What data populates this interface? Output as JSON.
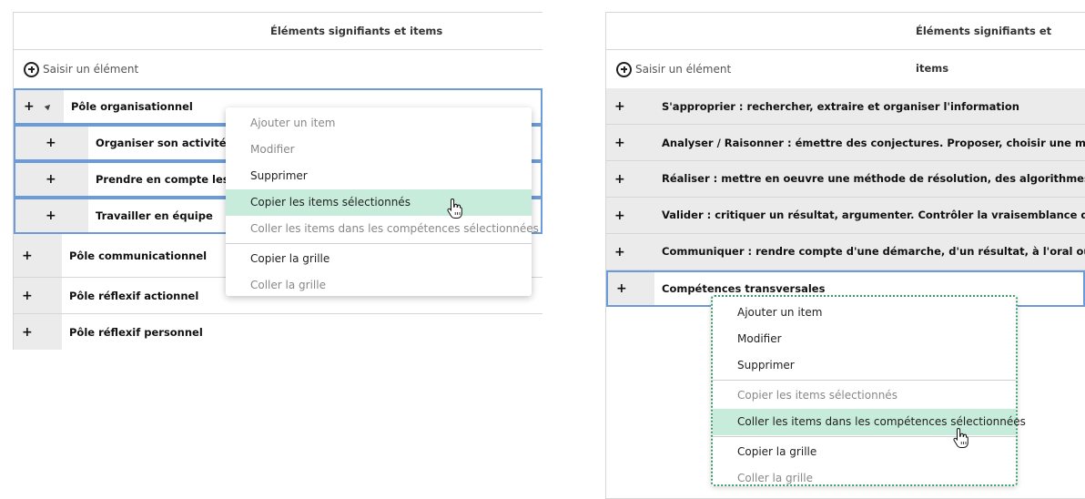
{
  "left_panel": {
    "header_title": "Éléments signifiants et items",
    "add_label": "Saisir un élément",
    "rows": [
      {
        "plus": "+",
        "label": "Pôle organisationnel"
      },
      {
        "plus": "+",
        "label": "Organiser son activité"
      },
      {
        "plus": "+",
        "label": "Prendre en compte les co"
      },
      {
        "plus": "+",
        "label": "Travailler en équipe"
      },
      {
        "plus": "+",
        "label": "Pôle communicationnel"
      },
      {
        "plus": "+",
        "label": "Pôle réflexif actionnel"
      },
      {
        "plus": "+",
        "label": "Pôle réflexif personnel"
      }
    ],
    "context_menu": {
      "items": [
        {
          "label": "Ajouter un item",
          "state": "disabled"
        },
        {
          "label": "Modifier",
          "state": "disabled"
        },
        {
          "label": "Supprimer",
          "state": "enabled"
        },
        {
          "label": "Copier les items sélectionnés",
          "state": "hover"
        },
        {
          "label": "Coller les items dans les compétences sélectionnées",
          "state": "disabled"
        },
        {
          "label": "Copier la grille",
          "state": "enabled"
        },
        {
          "label": "Coller la grille",
          "state": "disabled"
        }
      ]
    }
  },
  "right_panel": {
    "header_title": "Éléments signifiants et items",
    "add_label": "Saisir un élément",
    "rows": [
      {
        "plus": "+",
        "label": "S'approprier : rechercher, extraire et organiser l'information"
      },
      {
        "plus": "+",
        "label": "Analyser / Raisonner : émettre des conjectures. Proposer, choisir une méthode de"
      },
      {
        "plus": "+",
        "label": "Réaliser : mettre en oeuvre une méthode de résolution, des algorithmes. Utiliser u simulation"
      },
      {
        "plus": "+",
        "label": "Valider : critiquer un résultat, argumenter. Contrôler la vraisemblance d'une conje conclusion"
      },
      {
        "plus": "+",
        "label": "Communiquer : rendre compte d'une démarche, d'un résultat, à l'oral ou à l'écrit à démarche"
      },
      {
        "plus": "+",
        "label": "Compétences transversales"
      }
    ],
    "context_menu": {
      "items": [
        {
          "label": "Ajouter un item",
          "state": "enabled"
        },
        {
          "label": "Modifier",
          "state": "enabled"
        },
        {
          "label": "Supprimer",
          "state": "enabled"
        },
        {
          "label": "Copier les items sélectionnés",
          "state": "disabled"
        },
        {
          "label": "Coller les items dans les compétences sélectionnées",
          "state": "hover"
        },
        {
          "label": "Copier la grille",
          "state": "enabled"
        },
        {
          "label": "Coller la grille",
          "state": "disabled"
        }
      ]
    }
  },
  "colors": {
    "selection_border": "#6b9bd8",
    "menu_hover": "#c8ecdc",
    "focus_dotted": "#3a9a6a",
    "row_grey": "#ebebeb"
  },
  "icons": [
    "plus-circle-icon",
    "expand-plus-icon",
    "collapse-triangle-icon",
    "hand-pointer-icon"
  ]
}
